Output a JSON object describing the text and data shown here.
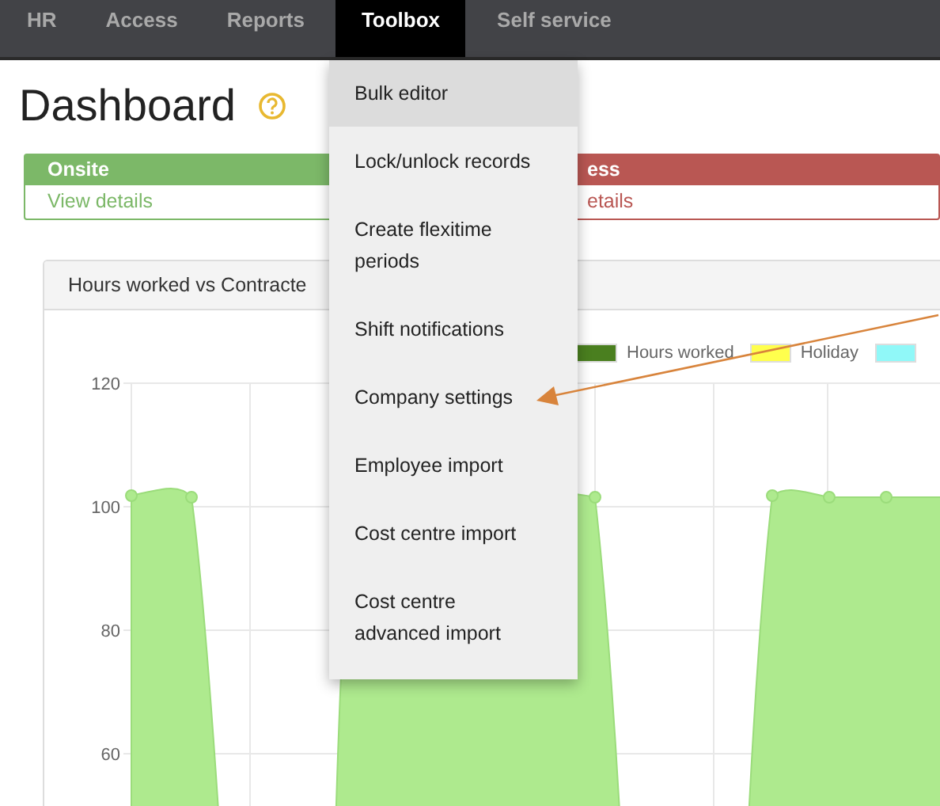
{
  "nav": {
    "items": [
      {
        "label": "HR",
        "selected": false
      },
      {
        "label": "Access",
        "selected": false
      },
      {
        "label": "Reports",
        "selected": false
      },
      {
        "label": "Toolbox",
        "selected": true
      },
      {
        "label": "Self service",
        "selected": false
      }
    ]
  },
  "page_title": "Dashboard",
  "status_cards": [
    {
      "title": "Onsite",
      "link": "View details",
      "color": "#7cb868"
    },
    {
      "title": "ess",
      "link": "etails",
      "color": "#b95753"
    }
  ],
  "chart_panel": {
    "title": "Hours worked vs Contracte",
    "legend": [
      {
        "label": "Hours worked",
        "color": "#4a7f1f"
      },
      {
        "label": "Holiday",
        "color": "#ffff4d"
      },
      {
        "color": "#90f8f8"
      }
    ],
    "y_tick_labels": [
      "120",
      "100",
      "80",
      "60"
    ]
  },
  "toolbox_menu": {
    "items": [
      {
        "label": "Bulk editor",
        "highlighted": true
      },
      {
        "label": "Lock/unlock records",
        "highlighted": false
      },
      {
        "label": "Create flexitime periods",
        "highlighted": false
      },
      {
        "label": "Shift notifications",
        "highlighted": false
      },
      {
        "label": "Company settings",
        "highlighted": false
      },
      {
        "label": "Employee import",
        "highlighted": false
      },
      {
        "label": "Cost centre import",
        "highlighted": false
      },
      {
        "label": "Cost centre advanced import",
        "highlighted": false
      }
    ]
  }
}
